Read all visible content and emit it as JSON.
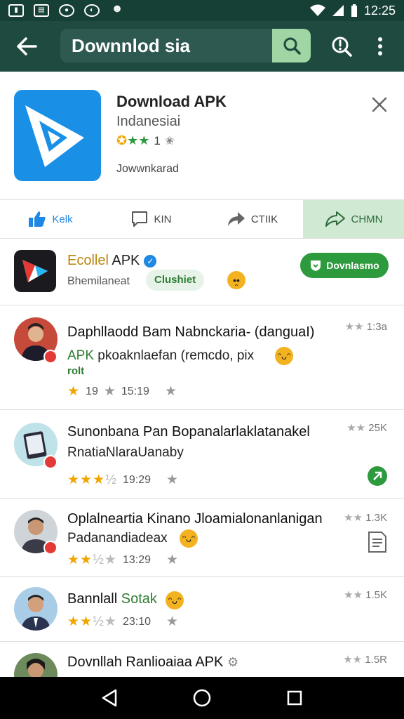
{
  "status_bar": {
    "icons": [
      "image-icon",
      "news-icon",
      "messenger-icon",
      "nfc-icon",
      "face-icon"
    ],
    "time": "12:25"
  },
  "app_bar": {
    "search_text": "Downnlod sia"
  },
  "header_card": {
    "title": "Download APK",
    "subtitle": "Indanesiai",
    "rating_count": "1",
    "meta": "Jowwnkarad"
  },
  "actions": [
    {
      "label": "Kelk",
      "icon": "thumbs-up-icon"
    },
    {
      "label": "KIN",
      "icon": "comment-icon"
    },
    {
      "label": "CTIIK",
      "icon": "share-icon"
    },
    {
      "label": "CHMN",
      "icon": "forward-icon"
    }
  ],
  "featured": {
    "title_highlight": "Ecollel",
    "title_rest": " APK",
    "subtitle": "Bhemilaneat",
    "chip": "Clushiet",
    "download_label": "Dovnlasmo"
  },
  "rows": [
    {
      "title": "Daphllaodd Bam Nabnckaria- (danguaI)",
      "line2_green": "APK",
      "line2": " pkoaknlaefan (remcdo, pix",
      "line3": "rolt",
      "rating_text": "19",
      "time": "15:19",
      "right": "1:3a"
    },
    {
      "title": "Sunonbana Pan Bopanalarlaklatanakel",
      "line2": "RnatiaNlaraUanaby",
      "time": "19:29",
      "right": "25K"
    },
    {
      "title": "Oplalneartia Kinano Jloamialonanlanigan",
      "line2": "Padanandiadeax",
      "time": "13:29",
      "right": "1.3K"
    },
    {
      "title": "Bannlall",
      "title_green": "Sotak",
      "time": "23:10",
      "right": "1.5K"
    },
    {
      "title": "Dovnllah Ranlioaiaa APK",
      "right": "1.5R"
    }
  ],
  "colors": {
    "app_bar": "#1f4a40",
    "status_bar": "#163f36",
    "accent_green": "#2e9a3e",
    "app_icon_blue": "#1a8fe6"
  }
}
